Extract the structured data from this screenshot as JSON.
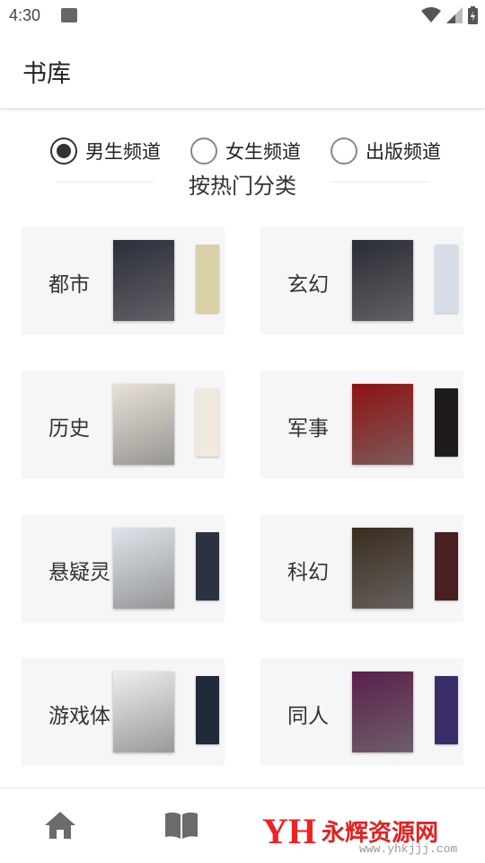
{
  "status": {
    "time": "4:30"
  },
  "header": {
    "title": "书库"
  },
  "channels": [
    {
      "label": "男生频道",
      "checked": true
    },
    {
      "label": "女生频道",
      "checked": false
    },
    {
      "label": "出版频道",
      "checked": false
    }
  ],
  "section": {
    "title": "按热门分类"
  },
  "categories": [
    {
      "label": "都市",
      "cover_front": "#2b2d3a",
      "cover_back": "#d9d2a8"
    },
    {
      "label": "玄幻",
      "cover_front": "#2a2c34",
      "cover_back": "#d7dde6"
    },
    {
      "label": "历史",
      "cover_front": "#e8e2d7",
      "cover_back": "#efe9df"
    },
    {
      "label": "军事",
      "cover_front": "#8d1212",
      "cover_back": "#1e1a1a"
    },
    {
      "label": "悬疑灵",
      "cover_front": "#dfe4ea",
      "cover_back": "#2b3240"
    },
    {
      "label": "科幻",
      "cover_front": "#3a2c1e",
      "cover_back": "#4a1f1f"
    },
    {
      "label": "游戏体",
      "cover_front": "#eeeeee",
      "cover_back": "#1f2a3a"
    },
    {
      "label": "同人",
      "cover_front": "#5a1f4a",
      "cover_back": "#3b2d6a"
    }
  ],
  "watermark": {
    "logo": "YH",
    "text": "永辉资源网",
    "url": "www.yhkjjj.com"
  },
  "icons": {
    "image": "image-icon",
    "wifi": "wifi-icon",
    "signal": "signal-icon",
    "battery": "battery-icon",
    "home": "home-icon",
    "bookshelf": "book-icon"
  }
}
